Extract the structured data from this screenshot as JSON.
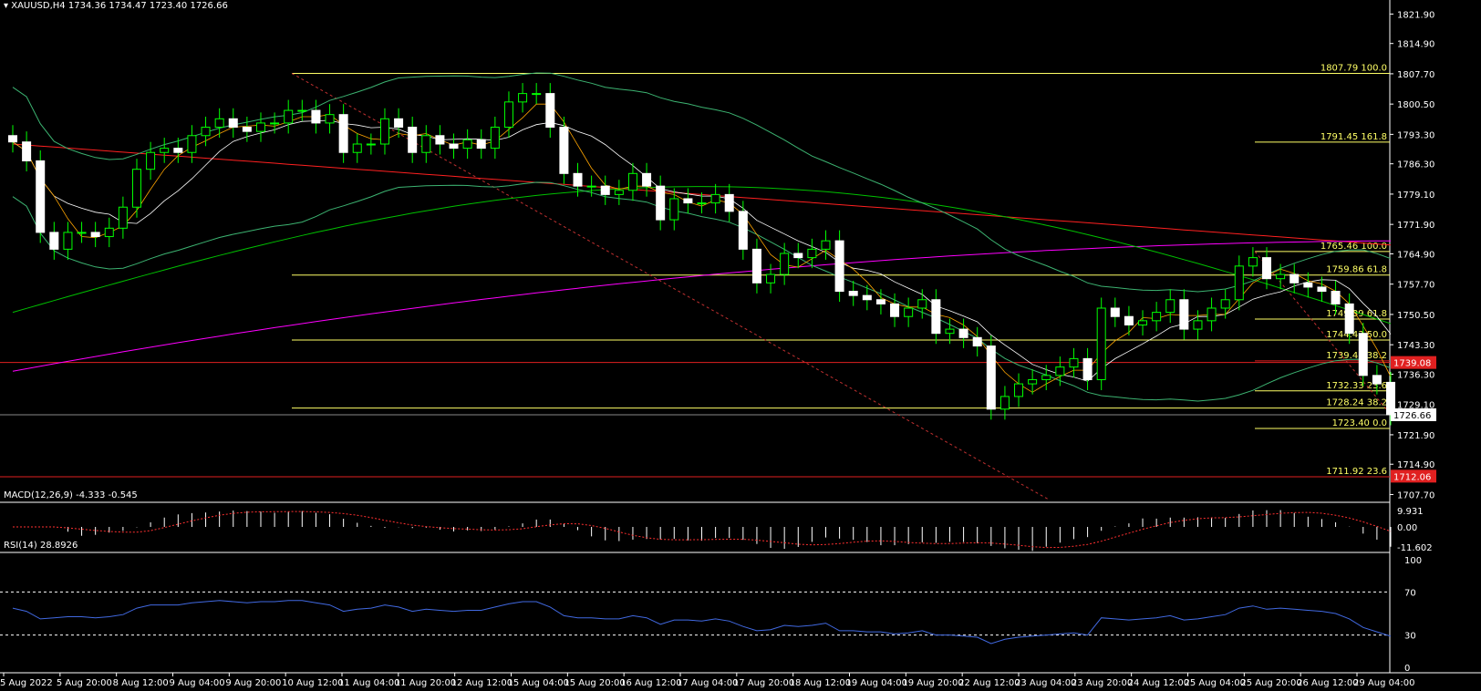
{
  "header": {
    "symbol_label": "XAUUSD,H4",
    "ohlc": "1734.36 1734.47 1723.40 1726.66"
  },
  "price_axis": {
    "ticks": [
      "1821.90",
      "1814.90",
      "1807.70",
      "1800.50",
      "1793.30",
      "1786.30",
      "1779.10",
      "1771.90",
      "1764.90",
      "1757.70",
      "1750.50",
      "1743.30",
      "1736.30",
      "1729.10",
      "1721.90",
      "1714.90",
      "1707.70"
    ],
    "current_price": "1726.66",
    "red_markers": [
      "1739.08",
      "1712.06"
    ]
  },
  "fib_labels": [
    {
      "text": "1807.79  100.0",
      "price": 1807.79
    },
    {
      "text": "1791.45  161.8",
      "price": 1791.45
    },
    {
      "text": "1765.46  100.0",
      "price": 1765.46
    },
    {
      "text": "1759.86  61.8",
      "price": 1759.86
    },
    {
      "text": "1749.39  61.8",
      "price": 1749.39
    },
    {
      "text": "1744.43  50.0",
      "price": 1744.43
    },
    {
      "text": "1739.47  38.2",
      "price": 1739.47
    },
    {
      "text": "1732.33  23.6",
      "price": 1732.33
    },
    {
      "text": "1728.24  38.2",
      "price": 1728.24
    },
    {
      "text": "1723.40  0.0",
      "price": 1723.4
    },
    {
      "text": "1711.92  23.6",
      "price": 1711.92
    }
  ],
  "time_axis": [
    "5 Aug 2022",
    "5 Aug 20:00",
    "8 Aug 12:00",
    "9 Aug 04:00",
    "9 Aug 20:00",
    "10 Aug 12:00",
    "11 Aug 04:00",
    "11 Aug 20:00",
    "12 Aug 12:00",
    "15 Aug 04:00",
    "15 Aug 20:00",
    "16 Aug 12:00",
    "17 Aug 04:00",
    "17 Aug 20:00",
    "18 Aug 12:00",
    "19 Aug 04:00",
    "19 Aug 20:00",
    "22 Aug 12:00",
    "23 Aug 04:00",
    "23 Aug 20:00",
    "24 Aug 12:00",
    "25 Aug 04:00",
    "25 Aug 20:00",
    "26 Aug 12:00",
    "29 Aug 04:00"
  ],
  "macd": {
    "label": "MACD(12,26,9) -4.333 -0.545",
    "ticks": [
      "9.931",
      "0.00",
      "-11.602"
    ]
  },
  "rsi": {
    "label": "RSI(14) 28.8926",
    "ticks": [
      "100",
      "70",
      "30",
      "0"
    ]
  },
  "colors": {
    "bull": "#ffffff",
    "bear": "#ffffff",
    "candle_wick": "#00ff00",
    "fib": "#ffff66",
    "ma_red": "#ff2020",
    "ma_magenta": "#ff00ff",
    "ma_green": "#00c000",
    "bands": "#3cb371",
    "rsi": "#4169e1"
  },
  "chart_data": {
    "type": "candlestick",
    "closes": [
      1791.5,
      1787,
      1770,
      1766,
      1770,
      1770,
      1769,
      1771,
      1776,
      1785,
      1789,
      1790,
      1789,
      1793,
      1795,
      1797,
      1795,
      1794,
      1796,
      1796,
      1799,
      1799,
      1796,
      1798,
      1789,
      1791,
      1791,
      1797,
      1795,
      1789,
      1793,
      1791,
      1790,
      1792,
      1790,
      1795,
      1801,
      1803,
      1803,
      1795,
      1784,
      1781,
      1781,
      1779,
      1780,
      1784,
      1781,
      1773,
      1778,
      1777,
      1777,
      1779,
      1775,
      1766,
      1758,
      1760,
      1765,
      1764,
      1766,
      1768,
      1756,
      1755,
      1754,
      1753,
      1750,
      1752,
      1754,
      1746,
      1747,
      1745,
      1743,
      1728,
      1731,
      1734,
      1735,
      1736,
      1738,
      1740,
      1735,
      1752,
      1750,
      1748,
      1749,
      1751,
      1754,
      1747,
      1749,
      1752,
      1754,
      1762,
      1764,
      1759,
      1760,
      1758,
      1757,
      1756,
      1753,
      1746,
      1736,
      1734,
      1726.66
    ],
    "opens": [
      1793,
      1791.5,
      1787,
      1770,
      1766,
      1770,
      1770,
      1769,
      1771,
      1776,
      1785,
      1789,
      1790,
      1789,
      1793,
      1795,
      1797,
      1795,
      1794,
      1796,
      1796,
      1799,
      1799,
      1796,
      1798,
      1789,
      1791,
      1791,
      1797,
      1795,
      1789,
      1793,
      1791,
      1790,
      1792,
      1790,
      1795,
      1801,
      1803,
      1803,
      1795,
      1784,
      1781,
      1781,
      1779,
      1780,
      1784,
      1781,
      1773,
      1778,
      1777,
      1777,
      1779,
      1775,
      1766,
      1758,
      1760,
      1765,
      1764,
      1766,
      1768,
      1756,
      1755,
      1754,
      1753,
      1750,
      1752,
      1754,
      1746,
      1747,
      1745,
      1743,
      1728,
      1731,
      1734,
      1735,
      1736,
      1738,
      1740,
      1735,
      1752,
      1750,
      1748,
      1749,
      1751,
      1754,
      1747,
      1749,
      1752,
      1754,
      1762,
      1764,
      1759,
      1760,
      1758,
      1757,
      1756,
      1753,
      1746,
      1736,
      1734.36
    ],
    "rsi": [
      55,
      52,
      45,
      46,
      47,
      47,
      46,
      47,
      49,
      55,
      58,
      58,
      58,
      60,
      61,
      62,
      61,
      60,
      61,
      61,
      62,
      62,
      60,
      58,
      52,
      54,
      55,
      58,
      56,
      52,
      54,
      53,
      52,
      53,
      53,
      56,
      59,
      61,
      61,
      56,
      48,
      46,
      46,
      45,
      45,
      48,
      46,
      40,
      44,
      44,
      43,
      45,
      43,
      38,
      34,
      35,
      39,
      38,
      39,
      41,
      34,
      34,
      33,
      33,
      31,
      32,
      34,
      30,
      30,
      29,
      28,
      22,
      26,
      28,
      29,
      30,
      31,
      32,
      30,
      46,
      45,
      44,
      45,
      46,
      48,
      44,
      45,
      47,
      49,
      55,
      57,
      54,
      55,
      54,
      53,
      52,
      50,
      45,
      37,
      33,
      28.9
    ]
  }
}
